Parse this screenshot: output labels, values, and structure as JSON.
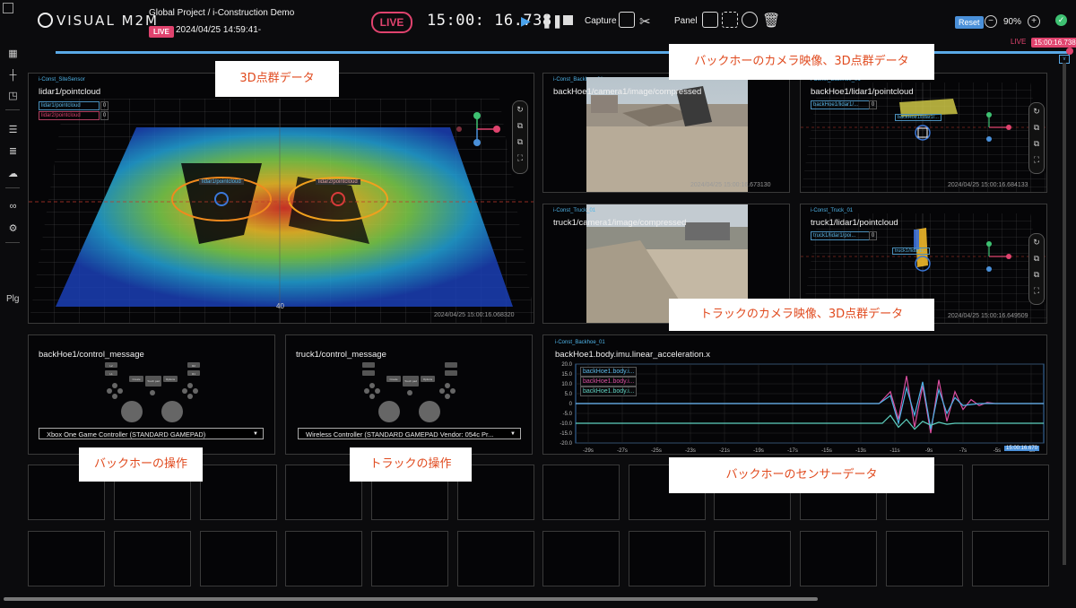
{
  "header": {
    "logo": "VISUAL M2M",
    "project": "Global Project / i-Construction Demo",
    "live_chip": "LIVE",
    "date": "2024/04/25 14:59:41-",
    "live_button": "LIVE",
    "clock": "15:00: 16.738",
    "capture_label": "Capture",
    "panel_label": "Panel",
    "reset_label": "Reset",
    "zoom": "90%"
  },
  "timeline": {
    "live": "LIVE",
    "time": "15:00:16.738"
  },
  "sidebar": {
    "plugin_label": "Plg"
  },
  "panels": {
    "site": {
      "tag": "i-Const_SiteSensor",
      "title": "lidar1/pointcloud",
      "chips": [
        "lidar1/pointcloud",
        "lidar2/pointcloud"
      ],
      "chip_values": [
        "0",
        "0"
      ],
      "timestamp": "2024/04/25 15:00:16.068320",
      "axis_label": "40",
      "overlay1": "lidar1/pointcloud",
      "overlay2": "lidar2/pointcloud"
    },
    "backhoe_cam": {
      "tag": "i-Const_Backhoe_01",
      "title": "backHoe1/camera1/image/compressed",
      "timestamp": "2024/04/25 15:00:16.673130"
    },
    "backhoe_lidar": {
      "tag": "i-Const_Backhoe_01",
      "title": "backHoe1/lidar1/pointcloud",
      "chip": "backHoe1/lidar1/...",
      "chip_value": "0",
      "overlay": "backHoe1/lidar1/...",
      "timestamp": "2024/04/25 15:00:16.684133"
    },
    "truck_cam": {
      "tag": "i-Const_Truck_01",
      "title": "truck1/camera1/image/compressed"
    },
    "truck_lidar": {
      "tag": "i-Const_Truck_01",
      "title": "truck1/lidar1/pointcloud",
      "chip": "truck1/lidar1/poi...",
      "chip_value": "0",
      "overlay": "truck1/lidar1/...",
      "timestamp": "2024/04/25 15:00:16.649509"
    },
    "backhoe_ctrl": {
      "title": "backHoe1/control_message",
      "select": "Xbox One Game Controller (STANDARD GAMEPAD)"
    },
    "truck_ctrl": {
      "title": "truck1/control_message",
      "select": "Wireless Controller (STANDARD GAMEPAD Vendor: 054c Pr..."
    },
    "imu": {
      "tag": "i-Const_Backhoe_01",
      "title": "backHoe1.body.imu.linear_acceleration.x",
      "legend": [
        "backHoe1.body.i...",
        "backHoe1.body.i...",
        "backHoe1.body.i..."
      ],
      "time_badge": "15:00:16.670"
    }
  },
  "gamepad_labels": [
    "Create",
    "Touch pad",
    "Options",
    "L2",
    "L1",
    "R2",
    "R1"
  ],
  "annotations": {
    "a1": "3D点群データ",
    "a2": "バックホーのカメラ映像、3D点群データ",
    "a3": "トラックのカメラ映像、3D点群データ",
    "a4": "バックホーの操作",
    "a5": "トラックの操作",
    "a6": "バックホーのセンサーデータ"
  },
  "colors": {
    "live": "#e0436e",
    "accent": "#5aa9e6",
    "ok": "#3ec172",
    "annotation": "#e04a1e"
  },
  "chart_data": {
    "type": "line",
    "title": "backHoe1.body.imu.linear_acceleration.x",
    "x_ticks": [
      "-29s",
      "-27s",
      "-25s",
      "-23s",
      "-21s",
      "-19s",
      "-17s",
      "-15s",
      "-13s",
      "-11s",
      "-9s",
      "-7s",
      "-5s",
      "-3s"
    ],
    "y_ticks": [
      "20.0",
      "15.0",
      "10.0",
      "5.0",
      "0",
      "-5.0",
      "-10.0",
      "-15.0",
      "-20.0"
    ],
    "ylim": [
      -20,
      20
    ],
    "xlim": [
      -30,
      -1
    ],
    "series": [
      {
        "name": "backHoe1.body.i...",
        "color": "#d94fa0",
        "baseline": 0,
        "x": [
          -30,
          -11.2,
          -10.5,
          -10,
          -9.5,
          -9,
          -8.5,
          -8,
          -7.5,
          -7,
          -6.5,
          -6,
          -5.5,
          -5,
          -4.5,
          -4,
          -1
        ],
        "y": [
          0,
          0,
          6,
          -8,
          14,
          -12,
          9,
          -15,
          12,
          -9,
          6,
          -3,
          2,
          -1,
          0.5,
          0,
          0
        ]
      },
      {
        "name": "backHoe1.body.i...",
        "color": "#4fb4e8",
        "baseline": 0,
        "x": [
          -30,
          -11.2,
          -10.5,
          -10,
          -9.5,
          -9,
          -8.5,
          -8,
          -7.5,
          -7,
          -6.5,
          -6,
          -5,
          -1
        ],
        "y": [
          0,
          0,
          4,
          -10,
          8,
          -6,
          11,
          -13,
          7,
          -5,
          3,
          -1,
          0,
          0
        ]
      },
      {
        "name": "backHoe1.body.i...",
        "color": "#5ed1c0",
        "baseline": -10,
        "x": [
          -30,
          -11,
          -10.5,
          -10,
          -9.5,
          -9,
          -8.5,
          -8,
          -7.5,
          -7,
          -6.5,
          -6,
          -1
        ],
        "y": [
          -10,
          -10,
          -6,
          -12,
          -8,
          -13,
          -9,
          -11,
          -9.5,
          -10.5,
          -10,
          -10,
          -10
        ]
      }
    ]
  }
}
